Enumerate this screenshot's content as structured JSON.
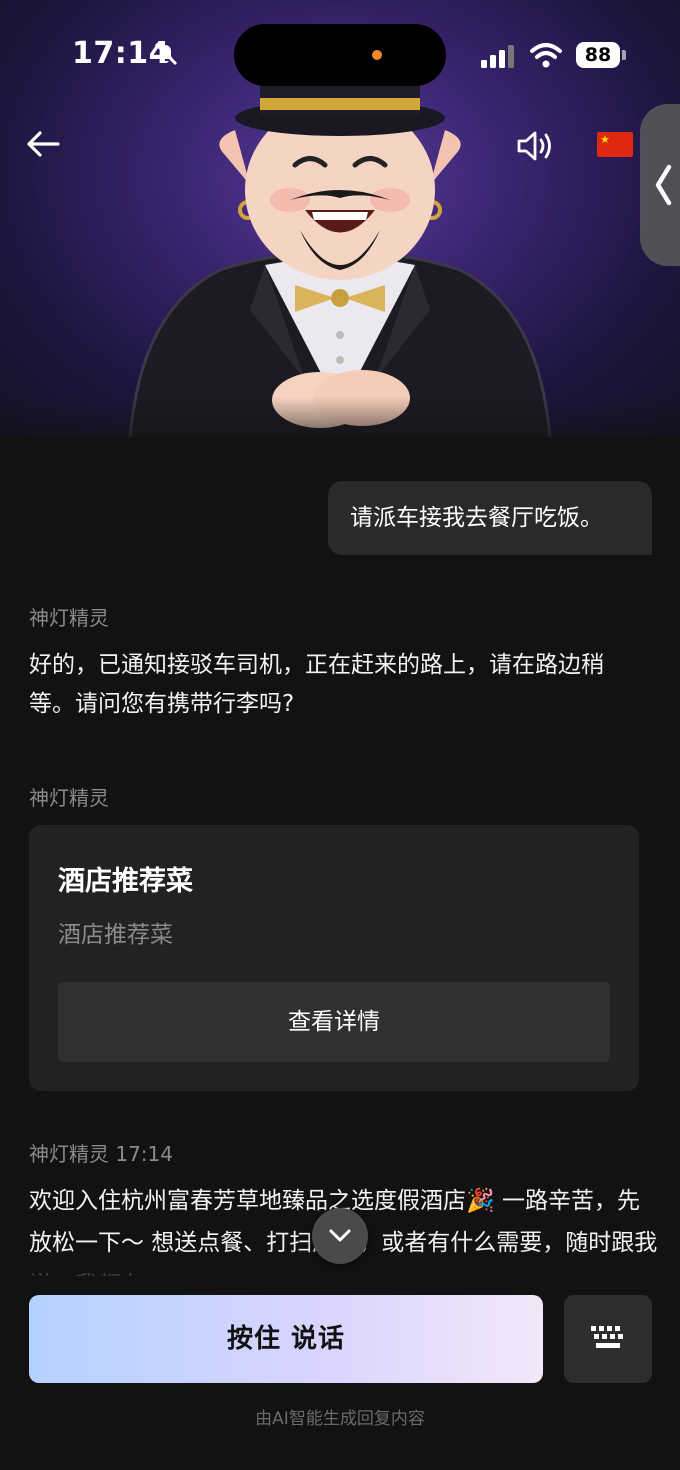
{
  "status_bar": {
    "time": "17:14",
    "battery": "88"
  },
  "header": {
    "back_icon": "arrow-left-icon",
    "speaker_icon": "speaker-icon",
    "flag_icon": "china-flag-icon",
    "side_panel_icon": "chevron-left-icon"
  },
  "chat": {
    "user_message": "请派车接我去餐厅吃饭。",
    "bot_name": "神灯精灵",
    "bot_reply": "好的，已通知接驳车司机，正在赶来的路上，请在路边稍等。请问您有携带行李吗?",
    "card_sender": "神灯精灵",
    "card": {
      "title": "酒店推荐菜",
      "subtitle": "酒店推荐菜",
      "button": "查看详情"
    },
    "last_sender": "神灯精灵 17:14",
    "last_message": "欢迎入住杭州富春芳草地臻品之选度假酒店🎉 一路辛苦，先放松一下～ 想送点餐、打扫房间，或者有什么需要，随时跟我说，我都在～"
  },
  "input": {
    "hold_to_talk": "按住 说话",
    "keyboard_icon": "keyboard-icon"
  },
  "footer": {
    "disclaimer": "由AI智能生成回复内容"
  }
}
